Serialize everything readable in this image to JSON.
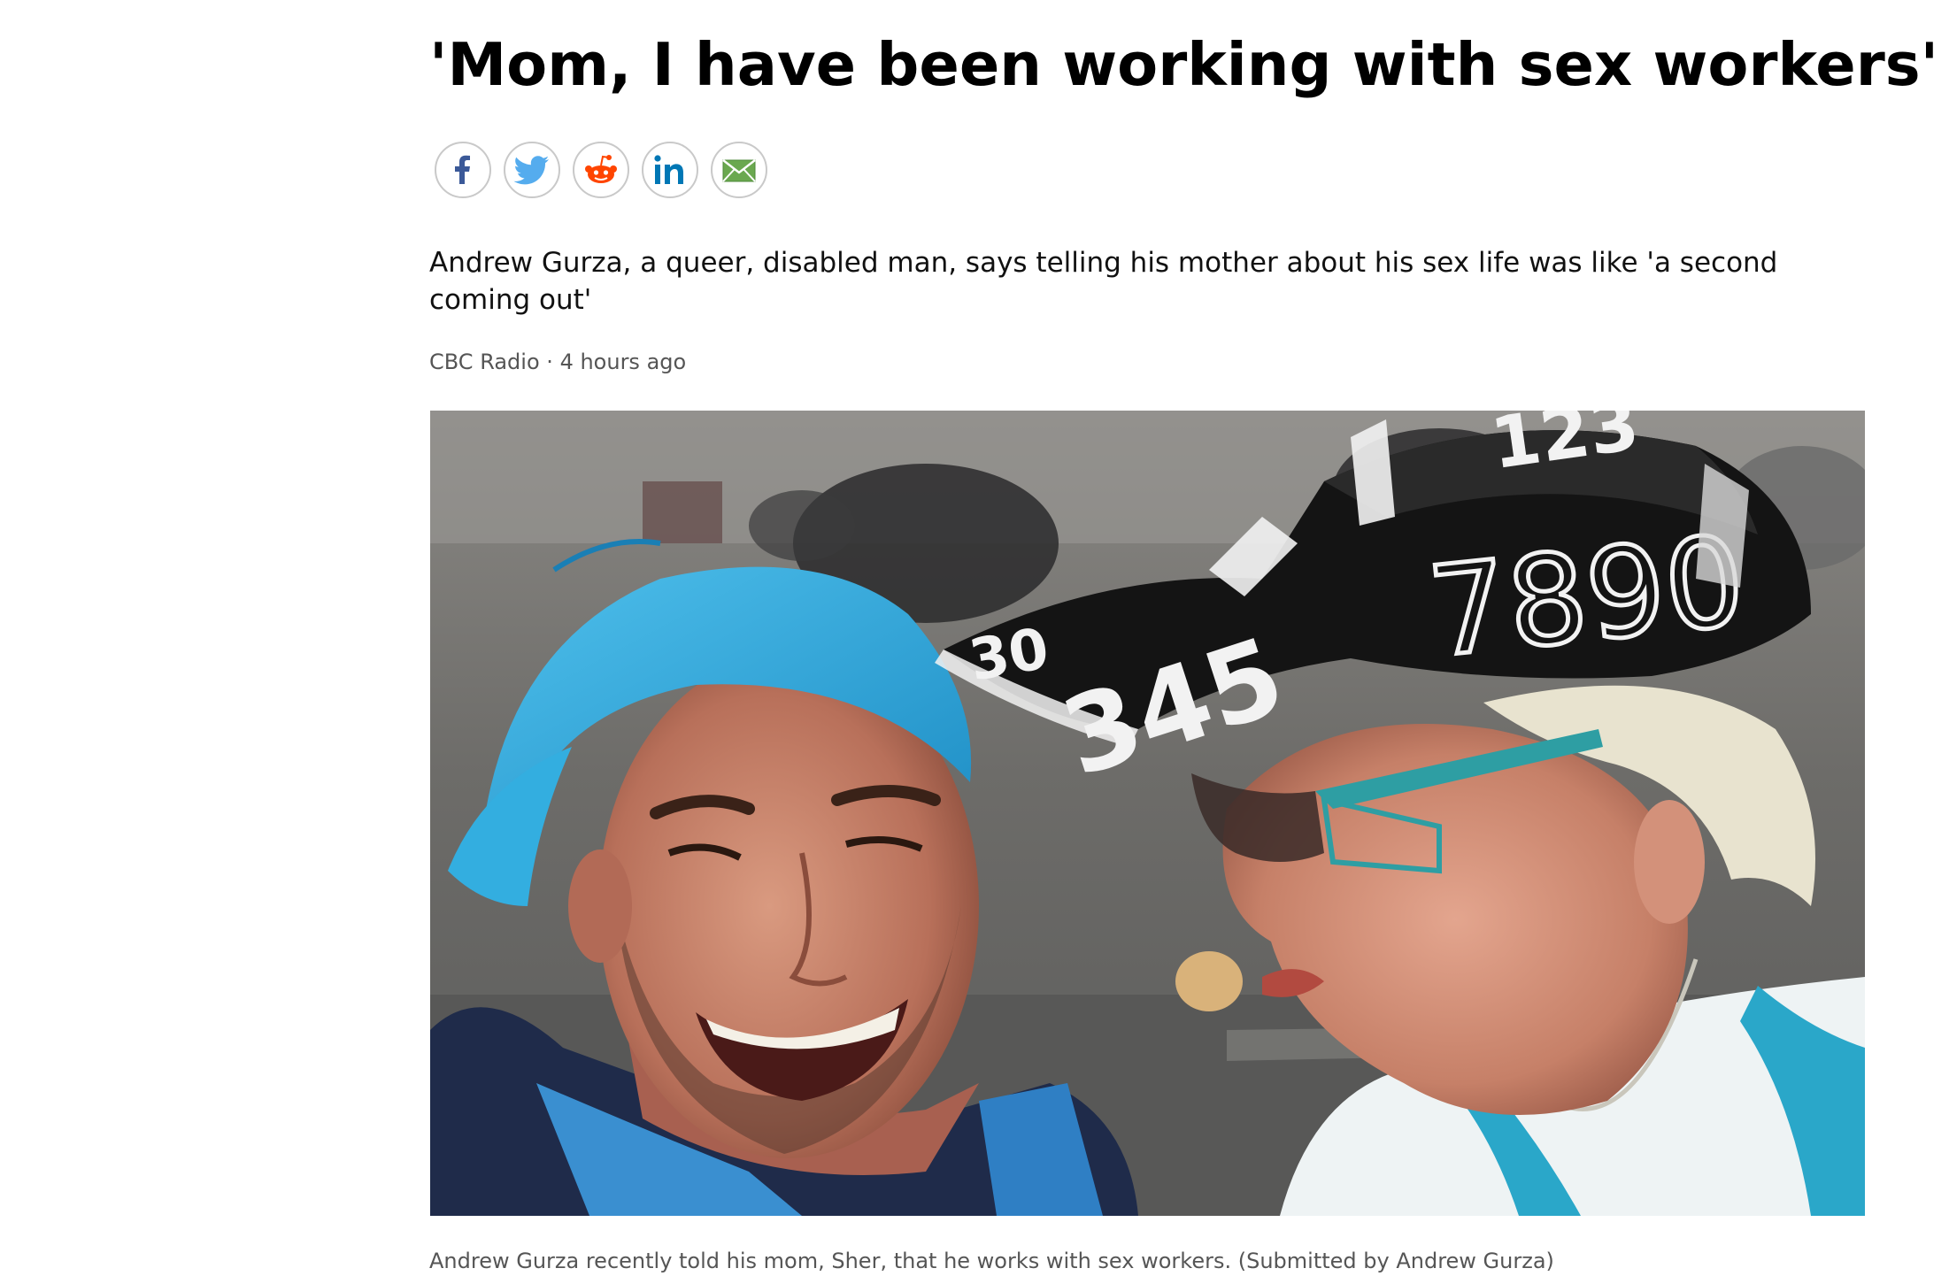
{
  "article": {
    "headline": "'Mom, I have been working with sex workers'",
    "deck": "Andrew Gurza, a queer, disabled man, says telling his mother about his sex life was like 'a second coming out'",
    "source": "CBC Radio",
    "separator": "·",
    "time_ago": "4 hours ago",
    "caption": "Andrew Gurza recently told his mom, Sher, that he works with sex workers. (Submitted by Andrew Gurza)"
  },
  "share": {
    "buttons": [
      {
        "icon": "facebook-icon",
        "color": "#3b5998"
      },
      {
        "icon": "twitter-icon",
        "color": "#55acee"
      },
      {
        "icon": "reddit-icon",
        "color": "#ff4500"
      },
      {
        "icon": "linkedin-icon",
        "color": "#0077b5"
      },
      {
        "icon": "email-icon",
        "color": "#5a9a4a"
      }
    ]
  },
  "photo": {
    "cap_text_left": "30",
    "cap_text_mid": "345",
    "cap_text_right": "7890",
    "cap_text_top": "123"
  },
  "colors": {
    "headline": "#000000",
    "meta": "#555555",
    "share_border": "#c9c9c9"
  }
}
